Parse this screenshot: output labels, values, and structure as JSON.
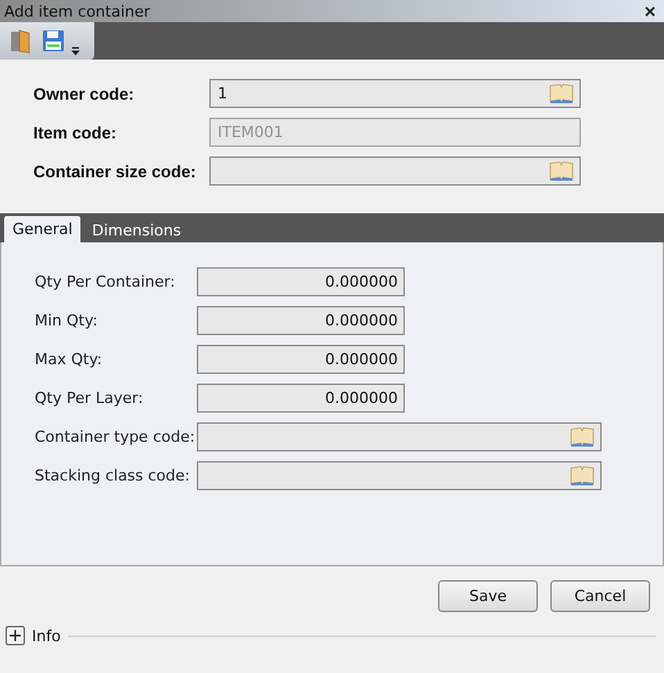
{
  "window": {
    "title": "Add item container",
    "close": "×"
  },
  "header_fields": [
    {
      "label": "Owner code:",
      "value": "1",
      "kind": "lookup",
      "disabled": false
    },
    {
      "label": "Item code:",
      "value": "ITEM001",
      "kind": "text",
      "disabled": true
    },
    {
      "label": "Container size code:",
      "kind": "lookup",
      "disabled": false
    }
  ],
  "tabs": [
    {
      "label": "General",
      "selected": true
    },
    {
      "label": "Dimensions",
      "selected": false
    }
  ],
  "general_fields": [
    {
      "label": "Qty Per Container:",
      "value": "0.000000",
      "kind": "number"
    },
    {
      "label": "Min Qty:",
      "value": "0.000000",
      "kind": "number"
    },
    {
      "label": "Max Qty:",
      "value": "0.000000",
      "kind": "number"
    },
    {
      "label": "Qty Per Layer:",
      "value": "0.000000",
      "kind": "number"
    },
    {
      "label": "Container type code:",
      "kind": "lookup"
    },
    {
      "label": "Stacking class code:",
      "kind": "lookup"
    }
  ],
  "buttons": [
    "Save",
    "Cancel"
  ],
  "info": {
    "label": "Info",
    "expanded": false
  }
}
